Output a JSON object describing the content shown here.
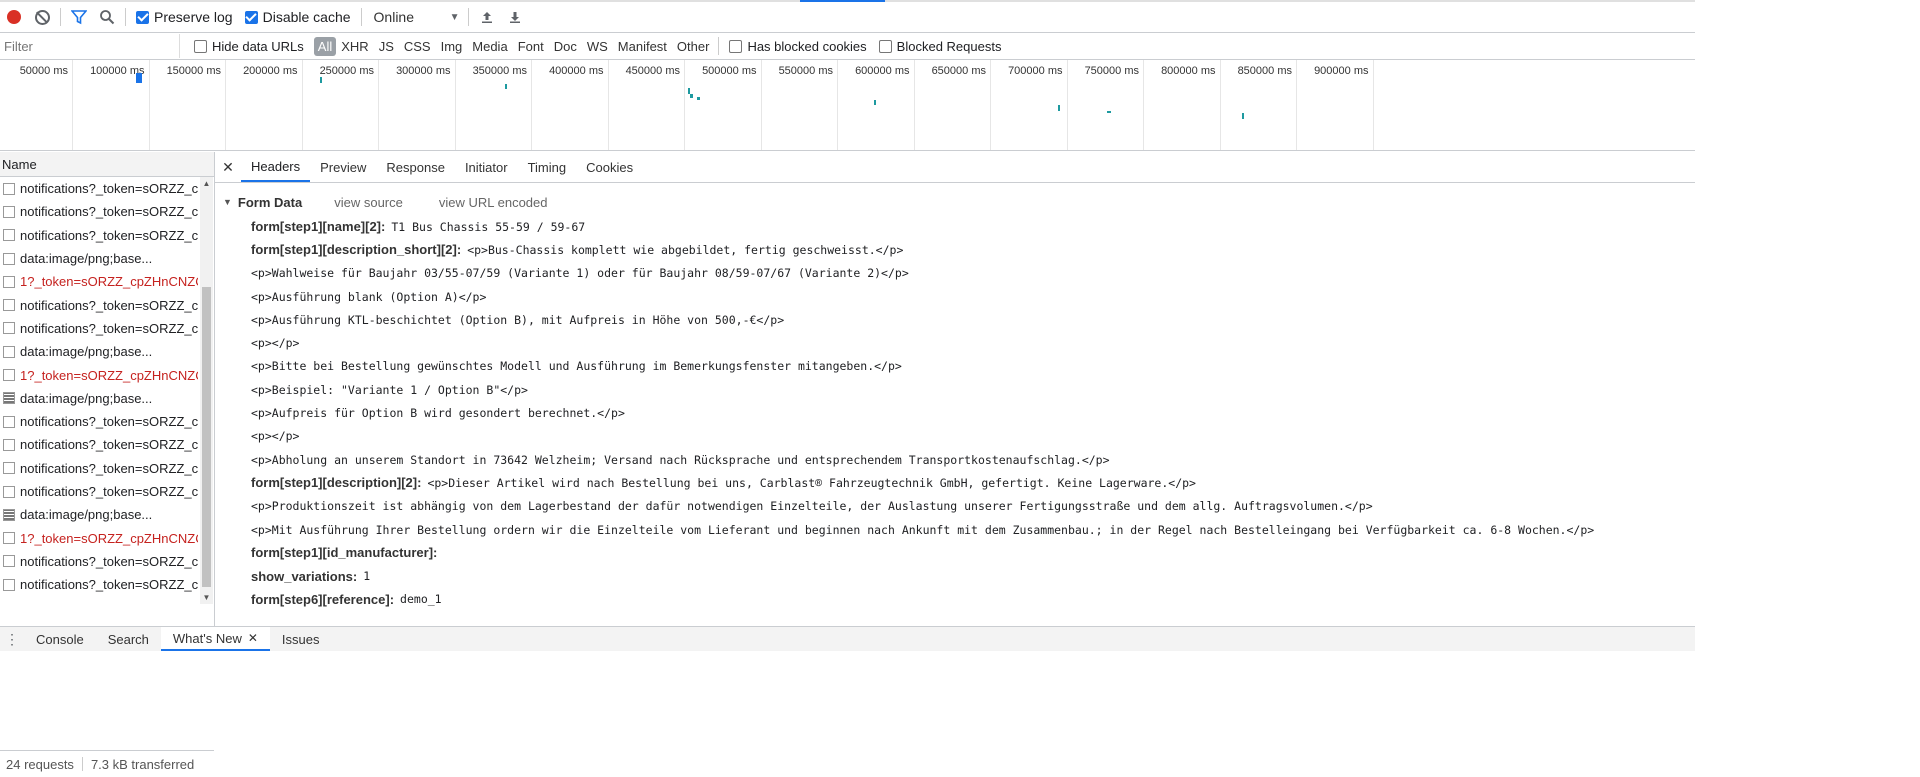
{
  "toolbar": {
    "preserve_log_label": "Preserve log",
    "preserve_log_checked": true,
    "disable_cache_label": "Disable cache",
    "disable_cache_checked": true,
    "throttle_value": "Online"
  },
  "filterbar": {
    "filter_placeholder": "Filter",
    "hide_data_urls_label": "Hide data URLs",
    "types": [
      "All",
      "XHR",
      "JS",
      "CSS",
      "Img",
      "Media",
      "Font",
      "Doc",
      "WS",
      "Manifest",
      "Other"
    ],
    "has_blocked_cookies_label": "Has blocked cookies",
    "blocked_requests_label": "Blocked Requests"
  },
  "overview": {
    "ticks": [
      "50000 ms",
      "100000 ms",
      "150000 ms",
      "200000 ms",
      "250000 ms",
      "300000 ms",
      "350000 ms",
      "400000 ms",
      "450000 ms",
      "500000 ms",
      "550000 ms",
      "600000 ms",
      "650000 ms",
      "700000 ms",
      "750000 ms",
      "800000 ms",
      "850000 ms",
      "900000 ms"
    ]
  },
  "requests": {
    "header": "Name",
    "items": [
      {
        "name": "notifications?_token=sORZZ_c",
        "type": "doc",
        "error": false
      },
      {
        "name": "notifications?_token=sORZZ_c",
        "type": "doc",
        "error": false
      },
      {
        "name": "notifications?_token=sORZZ_c",
        "type": "doc",
        "error": false
      },
      {
        "name": "data:image/png;base...",
        "type": "doc",
        "error": false
      },
      {
        "name": "1?_token=sORZZ_cpZHnCNZC",
        "type": "doc",
        "error": true
      },
      {
        "name": "notifications?_token=sORZZ_c",
        "type": "doc",
        "error": false
      },
      {
        "name": "notifications?_token=sORZZ_c",
        "type": "doc",
        "error": false
      },
      {
        "name": "data:image/png;base...",
        "type": "doc",
        "error": false
      },
      {
        "name": "1?_token=sORZZ_cpZHnCNZC",
        "type": "doc",
        "error": true
      },
      {
        "name": "data:image/png;base...",
        "type": "img",
        "error": false
      },
      {
        "name": "notifications?_token=sORZZ_c",
        "type": "doc",
        "error": false
      },
      {
        "name": "notifications?_token=sORZZ_c",
        "type": "doc",
        "error": false
      },
      {
        "name": "notifications?_token=sORZZ_c",
        "type": "doc",
        "error": false
      },
      {
        "name": "notifications?_token=sORZZ_c",
        "type": "doc",
        "error": false
      },
      {
        "name": "data:image/png;base...",
        "type": "img",
        "error": false
      },
      {
        "name": "1?_token=sORZZ_cpZHnCNZC",
        "type": "doc",
        "error": true
      },
      {
        "name": "notifications?_token=sORZZ_c",
        "type": "doc",
        "error": false
      },
      {
        "name": "notifications?_token=sORZZ_c",
        "type": "doc",
        "error": false
      }
    ],
    "status_count": "24 requests",
    "status_transferred": "7.3 kB transferred"
  },
  "details": {
    "tabs": [
      "Headers",
      "Preview",
      "Response",
      "Initiator",
      "Timing",
      "Cookies"
    ],
    "active_tab": "Headers",
    "form_data": {
      "title": "Form Data",
      "view_source": "view source",
      "view_url_encoded": "view URL encoded",
      "lines": [
        {
          "key": "form[step1][name][2]:",
          "value": "T1 Bus Chassis 55-59 / 59-67"
        },
        {
          "key": "form[step1][description_short][2]:",
          "value": "<p>Bus-Chassis komplett wie abgebildet, fertig geschweisst.</p>"
        },
        {
          "key": "",
          "value": "<p>Wahlweise für Baujahr 03/55-07/59 (Variante 1) oder für Baujahr 08/59-07/67 (Variante 2)</p>"
        },
        {
          "key": "",
          "value": "<p>Ausführung blank (Option A)</p>"
        },
        {
          "key": "",
          "value": "<p>Ausführung KTL-beschichtet (Option B), mit Aufpreis in Höhe von 500,-€</p>"
        },
        {
          "key": "",
          "value": "<p></p>"
        },
        {
          "key": "",
          "value": "<p>Bitte bei Bestellung gewünschtes Modell und Ausführung im Bemerkungsfenster mitangeben.</p>"
        },
        {
          "key": "",
          "value": "<p>Beispiel: \"Variante 1 / Option B\"</p>"
        },
        {
          "key": "",
          "value": "<p>Aufpreis für Option B wird gesondert berechnet.</p>"
        },
        {
          "key": "",
          "value": "<p></p>"
        },
        {
          "key": "",
          "value": "<p>Abholung an unserem Standort in 73642 Welzheim; Versand nach Rücksprache und entsprechendem Transportkostenaufschlag.</p>"
        },
        {
          "key": "form[step1][description][2]:",
          "value": "<p>Dieser Artikel wird nach Bestellung bei uns, Carblast® Fahrzeugtechnik GmbH, gefertigt. Keine Lagerware.</p>"
        },
        {
          "key": "",
          "value": "<p>Produktionszeit ist abhängig von dem Lagerbestand der dafür notwendigen Einzelteile, der Auslastung unserer Fertigungsstraße und dem allg. Auftragsvolumen.</p>"
        },
        {
          "key": "",
          "value": "<p>Mit Ausführung Ihrer Bestellung ordern wir die Einzelteile vom Lieferant und beginnen nach Ankunft mit dem Zusammenbau.; in der Regel nach Bestelleingang bei Verfügbarkeit ca. 6-8 Wochen.</p>"
        },
        {
          "key": "form[step1][id_manufacturer]:",
          "value": ""
        },
        {
          "key": "show_variations:",
          "value": "1"
        },
        {
          "key": "form[step6][reference]:",
          "value": "demo_1"
        }
      ]
    }
  },
  "drawer": {
    "tabs": [
      "Console",
      "Search",
      "What's New",
      "Issues"
    ],
    "active_tab": "What's New"
  },
  "colors": {
    "accent": "#1a73e8",
    "record": "#d93025",
    "error_text": "#c5221f",
    "timeline_mark": "#1e9aa0"
  }
}
